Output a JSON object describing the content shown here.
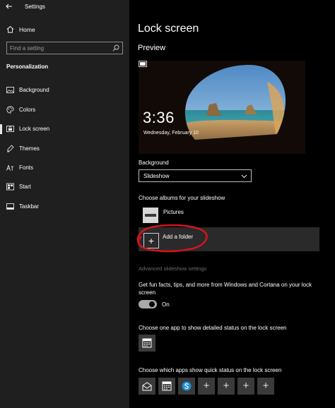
{
  "window": {
    "title": "Settings"
  },
  "sidebar": {
    "home_label": "Home",
    "search_placeholder": "Find a setting",
    "section_title": "Personalization",
    "items": [
      {
        "label": "Background",
        "icon": "picture-icon"
      },
      {
        "label": "Colors",
        "icon": "palette-icon"
      },
      {
        "label": "Lock screen",
        "icon": "lock-screen-icon",
        "active": true
      },
      {
        "label": "Themes",
        "icon": "themes-icon"
      },
      {
        "label": "Fonts",
        "icon": "fonts-icon"
      },
      {
        "label": "Start",
        "icon": "start-icon"
      },
      {
        "label": "Taskbar",
        "icon": "taskbar-icon"
      }
    ]
  },
  "main": {
    "title": "Lock screen",
    "preview_title": "Preview",
    "preview": {
      "time": "3:36",
      "date": "Wednesday, February 10"
    },
    "background_label": "Background",
    "background_value": "Slideshow",
    "albums_label": "Choose albums for your slideshow",
    "album_name": "Pictures",
    "add_folder_label": "Add a folder",
    "advanced_link": "Advanced slideshow settings",
    "facts_label": "Get fun facts, tips, and more from Windows and Cortana on your lock screen",
    "toggle_label": "On",
    "toggle_on": true,
    "detail_label": "Choose one app to show detailed status on the lock screen",
    "quick_label": "Choose which apps show quick status on the lock screen"
  },
  "colors": {
    "sidebar_bg": "#1f1f1f",
    "main_bg": "#000000",
    "highlight_bg": "#2a2a2a",
    "annotation_red": "#d4141c",
    "disabled_text": "#6c6c6c"
  }
}
